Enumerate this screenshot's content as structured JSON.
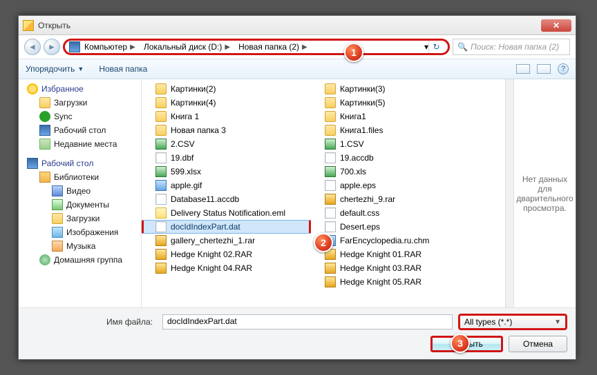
{
  "title": "Открыть",
  "breadcrumb": [
    "Компьютер",
    "Локальный диск (D:)",
    "Новая папка (2)"
  ],
  "search_placeholder": "Поиск: Новая папка (2)",
  "toolbar": {
    "organize": "Упорядочить",
    "newfolder": "Новая папка"
  },
  "sidebar": {
    "favorites": {
      "label": "Избранное",
      "items": [
        {
          "label": "Загрузки",
          "icon": "i-folder"
        },
        {
          "label": "Sync",
          "icon": "i-sync"
        },
        {
          "label": "Рабочий стол",
          "icon": "i-desk"
        },
        {
          "label": "Недавние места",
          "icon": "i-recent"
        }
      ]
    },
    "desktop": {
      "label": "Рабочий стол",
      "items": [
        {
          "label": "Библиотеки",
          "icon": "i-lib"
        },
        {
          "label": "Видео",
          "icon": "i-vid"
        },
        {
          "label": "Документы",
          "icon": "i-doc"
        },
        {
          "label": "Загрузки",
          "icon": "i-folder"
        },
        {
          "label": "Изображения",
          "icon": "i-pic"
        },
        {
          "label": "Музыка",
          "icon": "i-mus"
        },
        {
          "label": "Домашняя группа",
          "icon": "i-grp"
        }
      ]
    }
  },
  "files": {
    "col1": [
      {
        "label": "Картинки(2)",
        "icon": "i-folder"
      },
      {
        "label": "Картинки(4)",
        "icon": "i-folder"
      },
      {
        "label": "Книга 1",
        "icon": "i-folder"
      },
      {
        "label": "Новая папка 3",
        "icon": "i-folder"
      },
      {
        "label": "2.CSV",
        "icon": "i-xls"
      },
      {
        "label": "19.dbf",
        "icon": "i-page"
      },
      {
        "label": "599.xlsx",
        "icon": "i-xls"
      },
      {
        "label": "apple.gif",
        "icon": "i-gif"
      },
      {
        "label": "Database11.accdb",
        "icon": "i-page"
      },
      {
        "label": "Delivery Status Notification.eml",
        "icon": "i-eml"
      },
      {
        "label": "docIdIndexPart.dat",
        "icon": "i-page",
        "selected": true
      },
      {
        "label": "gallery_chertezhi_1.rar",
        "icon": "i-rar"
      },
      {
        "label": "Hedge Knight 02.RAR",
        "icon": "i-rar"
      },
      {
        "label": "Hedge Knight 04.RAR",
        "icon": "i-rar"
      }
    ],
    "col2": [
      {
        "label": "Картинки(3)",
        "icon": "i-folder"
      },
      {
        "label": "Картинки(5)",
        "icon": "i-folder"
      },
      {
        "label": "Книга1",
        "icon": "i-folder"
      },
      {
        "label": "Книга1.files",
        "icon": "i-folder"
      },
      {
        "label": "1.CSV",
        "icon": "i-xls"
      },
      {
        "label": "19.accdb",
        "icon": "i-page"
      },
      {
        "label": "700.xls",
        "icon": "i-xls"
      },
      {
        "label": "apple.eps",
        "icon": "i-page"
      },
      {
        "label": "chertezhi_9.rar",
        "icon": "i-rar"
      },
      {
        "label": "default.css",
        "icon": "i-page"
      },
      {
        "label": "Desert.eps",
        "icon": "i-page"
      },
      {
        "label": "FarEncyclopedia.ru.chm",
        "icon": "i-chm"
      },
      {
        "label": "Hedge Knight 01.RAR",
        "icon": "i-rar"
      },
      {
        "label": "Hedge Knight 03.RAR",
        "icon": "i-rar"
      },
      {
        "label": "Hedge Knight 05.RAR",
        "icon": "i-rar"
      }
    ]
  },
  "preview": "Нет данных для дварительного просмотра.",
  "filename_label": "Имя файла:",
  "filename_value": "docIdIndexPart.dat",
  "filter": "All types (*.*)",
  "open_btn": "Открыть",
  "cancel_btn": "Отмена",
  "annots": [
    "1",
    "2",
    "3"
  ]
}
